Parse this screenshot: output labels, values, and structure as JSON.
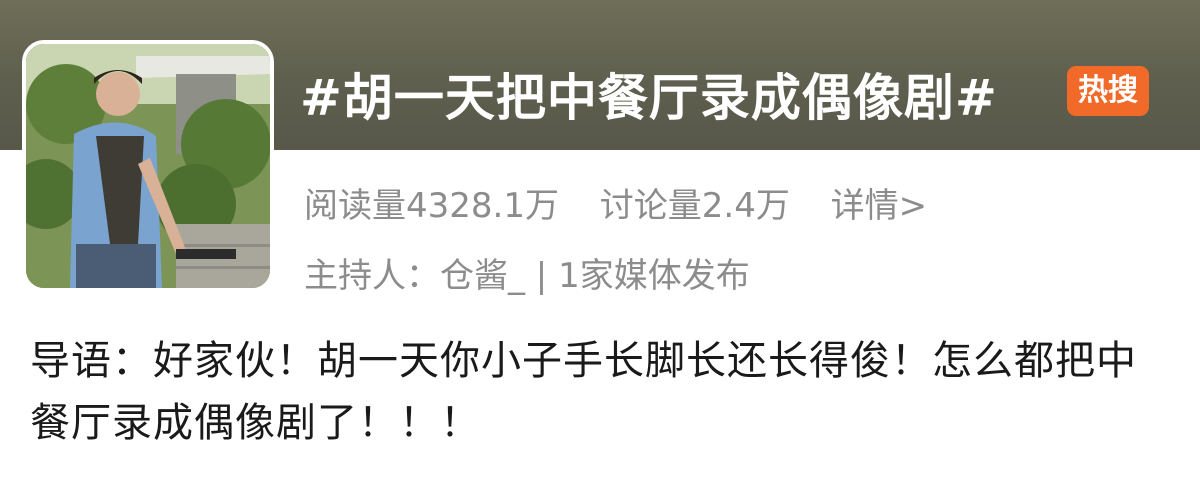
{
  "topic": {
    "title": "#胡一天把中餐厅录成偶像剧#",
    "badge": "热搜"
  },
  "stats": {
    "reads": "阅读量4328.1万",
    "discussions": "讨论量2.4万",
    "details": "详情>"
  },
  "host": {
    "text": "主持人：仓酱_ | 1家媒体发布"
  },
  "intro": {
    "text": "导语：好家伙！胡一天你小子手长脚长还长得俊！怎么都把中餐厅录成偶像剧了！！！"
  },
  "colors": {
    "banner": "#5e5f4e",
    "badge": "#f26a2a",
    "secondary_text": "#8c8c8c"
  }
}
